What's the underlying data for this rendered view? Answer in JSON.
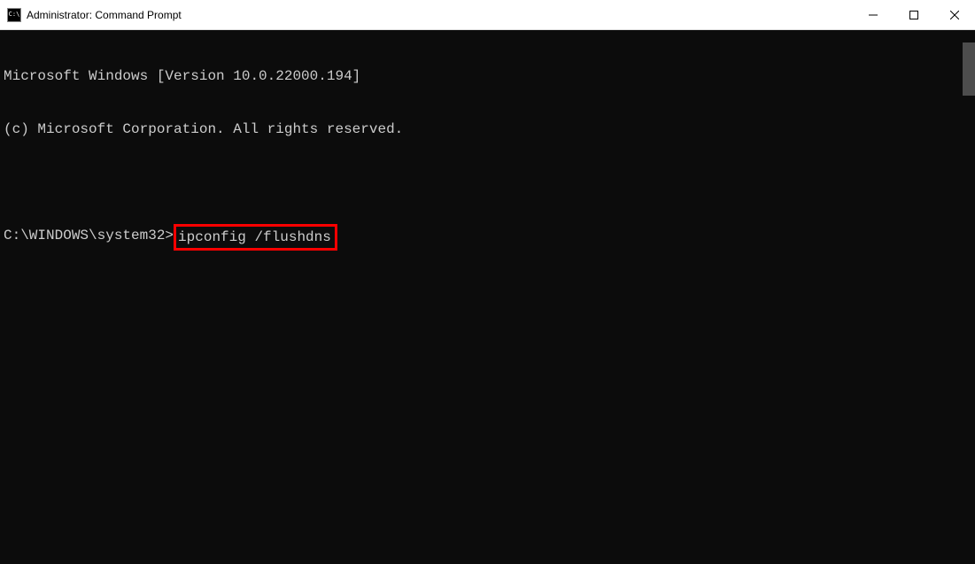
{
  "window": {
    "title": "Administrator: Command Prompt",
    "icon_label": "C:\\"
  },
  "terminal": {
    "line1": "Microsoft Windows [Version 10.0.22000.194]",
    "line2": "(c) Microsoft Corporation. All rights reserved.",
    "prompt": "C:\\WINDOWS\\system32>",
    "command": "ipconfig /flushdns"
  },
  "highlight": {
    "color": "#ff0000"
  }
}
